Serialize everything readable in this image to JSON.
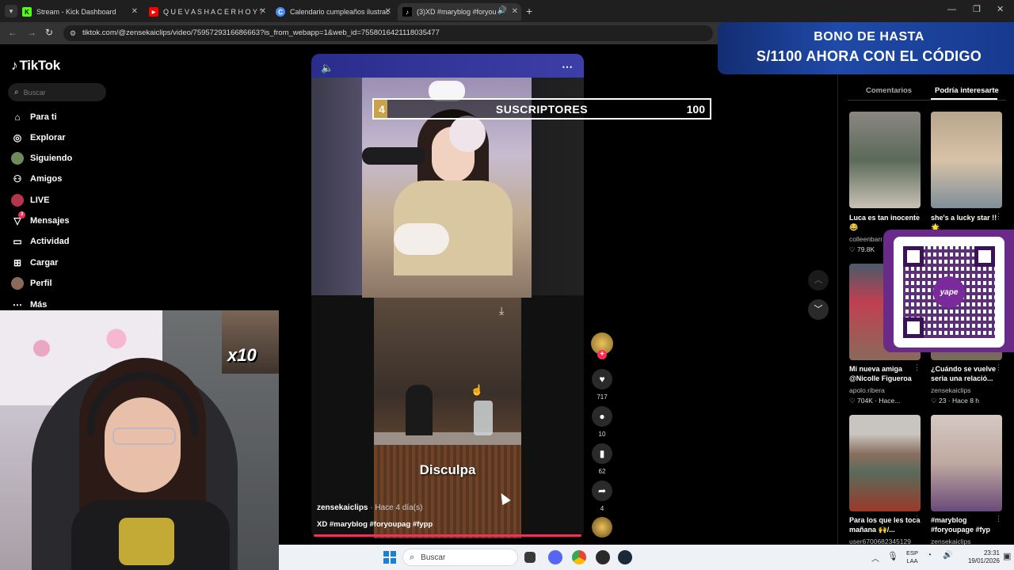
{
  "browser": {
    "tabs": [
      {
        "label": "Stream - Kick Dashboard",
        "favicon": "K"
      },
      {
        "label": "Q U E V A S H A C E R H O Y ?",
        "favicon": "▶"
      },
      {
        "label": "Calendario cumpleaños ilustrac",
        "favicon": "C"
      },
      {
        "label": "(3)XD #maryblog #foryoup",
        "favicon": "♪"
      }
    ],
    "url": "tiktok.com/@zensekaiclips/video/7595729316686663?is_from_webapp=1&web_id=7558016421118035477"
  },
  "sidebar": {
    "logo": "TikTok",
    "search_placeholder": "Buscar",
    "items": [
      {
        "label": "Para ti",
        "icon": "home-icon"
      },
      {
        "label": "Explorar",
        "icon": "compass-icon"
      },
      {
        "label": "Siguiendo",
        "icon": "following-avatar-icon"
      },
      {
        "label": "Amigos",
        "icon": "friends-icon"
      },
      {
        "label": "LIVE",
        "icon": "live-icon"
      },
      {
        "label": "Mensajes",
        "icon": "message-icon",
        "badge": "3"
      },
      {
        "label": "Actividad",
        "icon": "activity-icon"
      },
      {
        "label": "Cargar",
        "icon": "upload-icon"
      },
      {
        "label": "Perfil",
        "icon": "profile-icon"
      },
      {
        "label": "Más",
        "icon": "more-icon"
      }
    ]
  },
  "overlay": {
    "sub_goal_current": "4",
    "sub_goal_label": "SUSCRIPTORES",
    "sub_goal_target": "100",
    "sub_goal_progress": 0.04,
    "multiplier": "x10",
    "promo_line1": "BONO DE HASTA",
    "promo_line2": "S/1100 AHORA CON EL CÓDIGO",
    "qr_label": "yape"
  },
  "video": {
    "caption_overlay": "Disculpa",
    "author": "zensekaiclips",
    "time": " · Hace 4 día(s)",
    "description": "XD #maryblog #foryoupag #fypp",
    "likes": "717",
    "comments": "10",
    "saves": "62",
    "shares": "4"
  },
  "right_panel": {
    "tabs": [
      "Comentarios",
      "Podría interesarte"
    ],
    "cards": [
      {
        "title": "Luca es tan inocente 😂",
        "user": "colleenbarr",
        "stat": "79.8K"
      },
      {
        "title": "she's a lucky star !! 🌟",
        "user": "",
        "stat": ""
      },
      {
        "title": "Mi nueva amiga @Nicolle Figueroa",
        "user": "apolo.ribera",
        "stat": "704K · Hace..."
      },
      {
        "title": "¿Cuándo se vuelve seria una relació...",
        "user": "zensekaiclips",
        "stat": "23 · Hace 8 h"
      },
      {
        "title": "Para los que les toca mañana 🙌/...",
        "user": "user6700682345129",
        "stat": ""
      },
      {
        "title": "#maryblog #foryoupage #fyp",
        "user": "zensekaiclips",
        "stat": ""
      }
    ]
  },
  "taskbar": {
    "search_placeholder": "Buscar",
    "lang1": "ESP",
    "lang2": "LAA",
    "time": "23:31",
    "date": "19/01/2026"
  },
  "colors": {
    "tiktok_red": "#fe2c55",
    "promo_blue": "#1a3b8c",
    "gold": "#c9a24a"
  }
}
